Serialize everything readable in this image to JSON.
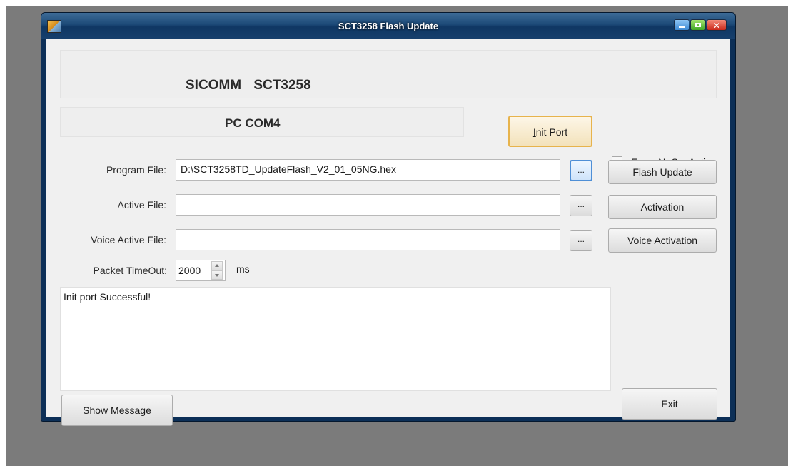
{
  "window": {
    "title": "SCT3258 Flash Update"
  },
  "header": {
    "title": "SICOMM   SCT3258"
  },
  "com": {
    "label": "PC COM4",
    "init_button_prefix": "I",
    "init_button_rest": "nit Port"
  },
  "options": {
    "erase_label": "EraseNoSysActive",
    "erase_checked": false
  },
  "files": {
    "program_label": "Program File:",
    "program_value": "D:\\SCT3258TD_UpdateFlash_V2_01_05NG.hex",
    "active_label": "Active File:",
    "active_value": "",
    "voice_label": "Voice Active File:",
    "voice_value": "",
    "browse_label": "..."
  },
  "timeout": {
    "label": "Packet TimeOut:",
    "value": "2000",
    "unit": "ms"
  },
  "actions": {
    "flash_update": "Flash Update",
    "activation": "Activation",
    "voice_activation": "Voice Activation",
    "show_message": "Show Message",
    "exit": "Exit"
  },
  "messages": {
    "text": "Init port Successful!"
  },
  "icons": {
    "app": "app-icon",
    "minimize": "minimize-icon",
    "maximize": "maximize-icon",
    "close": "close-icon"
  }
}
